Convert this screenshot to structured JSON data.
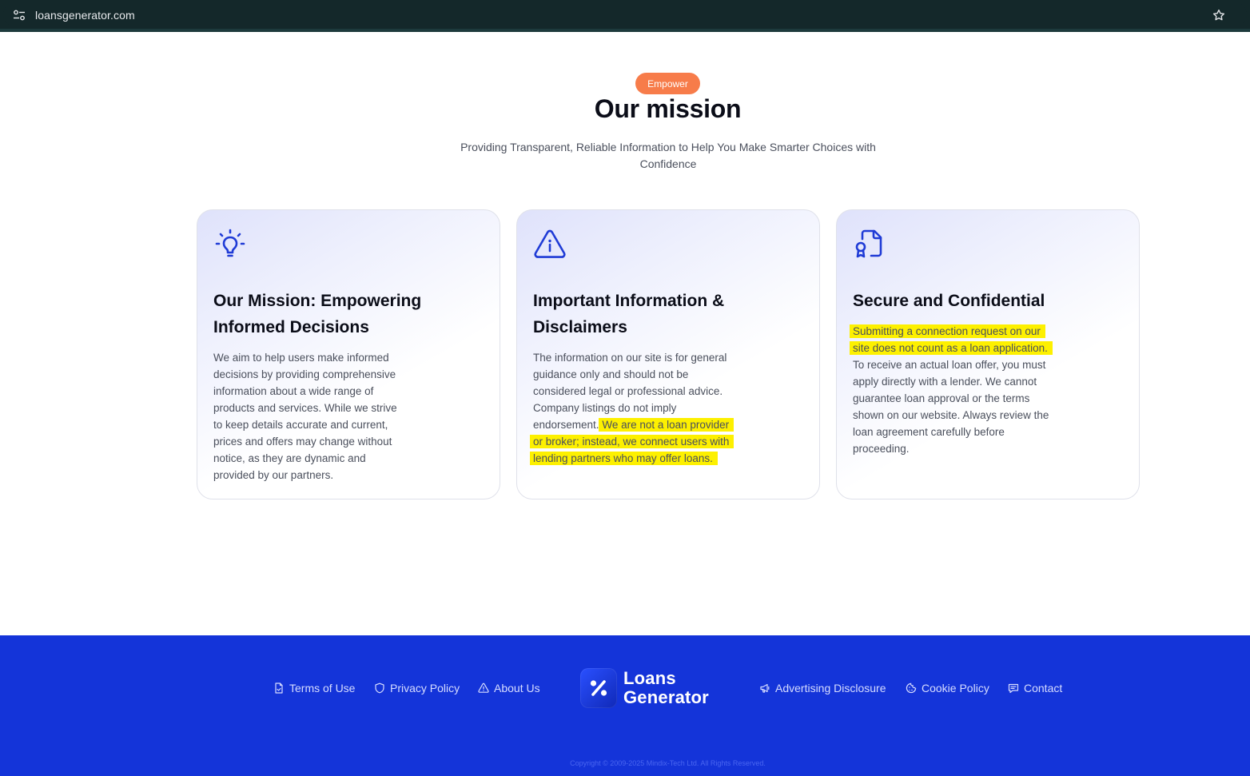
{
  "browser": {
    "url": "loansgenerator.com"
  },
  "hero": {
    "badge": "Empower",
    "title": "Our mission",
    "subtitle": "Providing Transparent, Reliable Information to Help You Make Smarter Choices with Confidence"
  },
  "cards": [
    {
      "icon": "lightbulb-icon",
      "title": "Our Mission: Empowering Informed Decisions",
      "text": "We aim to help users make informed decisions by providing comprehensive information about a wide range of products and services. While we strive to keep details accurate and current, prices and offers may change without notice, as they are dynamic and provided by our partners."
    },
    {
      "icon": "warning-info-icon",
      "title": "Important Information & Disclaimers",
      "text_plain": "The information on our site is for general guidance only and should not be considered legal or professional advice. Company listings do not imply endorsement.",
      "text_highlight": "We are not a loan provider or broker; instead, we connect users with lending partners who may offer loans."
    },
    {
      "icon": "document-certificate-icon",
      "title": "Secure and Confidential",
      "text_highlight": "Submitting a connection request on our site does not count as a loan application.",
      "text_plain": "To receive an actual loan offer, you must apply directly with a lender. We cannot guarantee loan approval or the terms shown on our website. Always review the loan agreement carefully before proceeding."
    }
  ],
  "footer": {
    "links_left": [
      {
        "label": "Terms of Use",
        "icon": "document-icon"
      },
      {
        "label": "Privacy Policy",
        "icon": "shield-icon"
      },
      {
        "label": "About Us",
        "icon": "warning-icon"
      }
    ],
    "logo": {
      "line1": "Loans",
      "line2": "Generator"
    },
    "links_right": [
      {
        "label": "Advertising Disclosure",
        "icon": "megaphone-icon"
      },
      {
        "label": "Cookie Policy",
        "icon": "cookie-icon"
      },
      {
        "label": "Contact",
        "icon": "chat-icon"
      }
    ],
    "copyright": "Copyright © 2009-2025 Mindix-Tech Ltd. All Rights Reserved."
  },
  "colors": {
    "accent_blue": "#1434d9",
    "badge_orange": "#f77c4a",
    "highlight_yellow": "#fdf000"
  }
}
